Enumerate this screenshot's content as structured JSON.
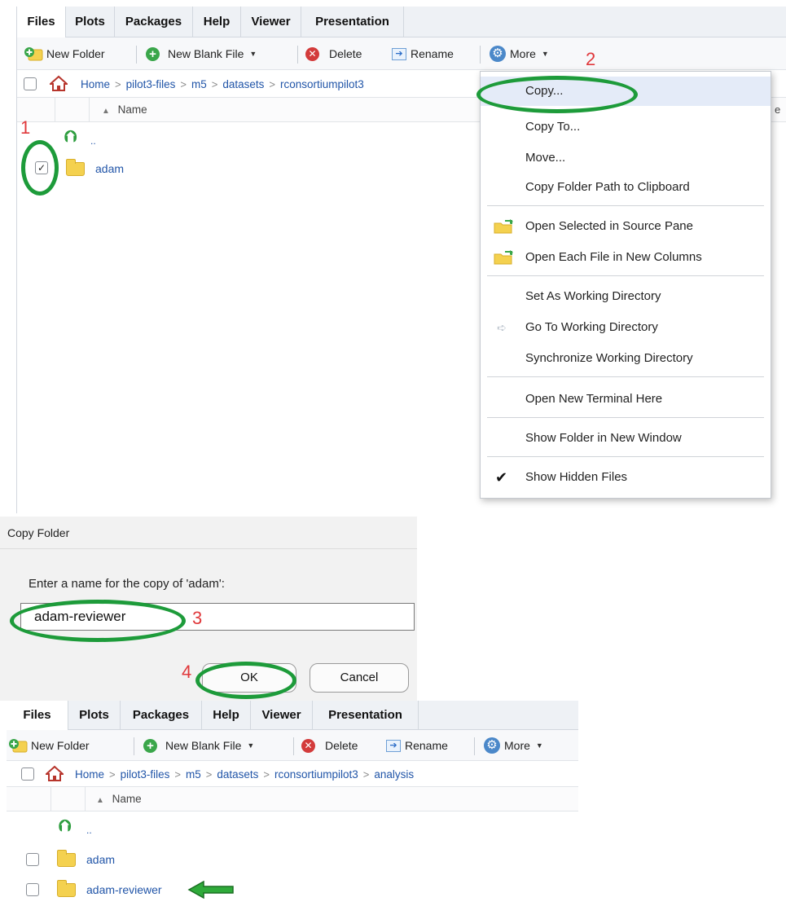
{
  "tabs": [
    "Files",
    "Plots",
    "Packages",
    "Help",
    "Viewer",
    "Presentation"
  ],
  "toolbar": {
    "new_folder": "New Folder",
    "new_blank_file": "New Blank File",
    "delete": "Delete",
    "rename": "Rename",
    "more": "More"
  },
  "breadcrumb_top": [
    "Home",
    "pilot3-files",
    "m5",
    "datasets",
    "rconsortiumpilot3"
  ],
  "breadcrumb_bottom": [
    "Home",
    "pilot3-files",
    "m5",
    "datasets",
    "rconsortiumpilot3",
    "analysis"
  ],
  "column_header": {
    "name": "Name",
    "right_edge": "e"
  },
  "parent_dir": "..",
  "files_top": [
    {
      "name": "adam",
      "checked": true
    }
  ],
  "files_bottom": [
    {
      "name": "adam",
      "checked": false
    },
    {
      "name": "adam-reviewer",
      "checked": false
    }
  ],
  "menu_items": [
    "Copy...",
    "Copy To...",
    "Move...",
    "Copy Folder Path to Clipboard",
    "Open Selected in Source Pane",
    "Open Each File in New Columns",
    "Set As Working Directory",
    "Go To Working Directory",
    "Synchronize Working Directory",
    "Open New Terminal Here",
    "Show Folder in New Window",
    "Show Hidden Files"
  ],
  "dialog": {
    "title": "Copy Folder",
    "prompt": "Enter a name for the copy of 'adam':",
    "input_value": "adam-reviewer",
    "ok": "OK",
    "cancel": "Cancel"
  },
  "annotations": [
    "1",
    "2",
    "3",
    "4"
  ],
  "colors": {
    "highlight_ellipse": "#1d9b3a",
    "annotation_number": "#e0383b",
    "link": "#2155a8"
  }
}
